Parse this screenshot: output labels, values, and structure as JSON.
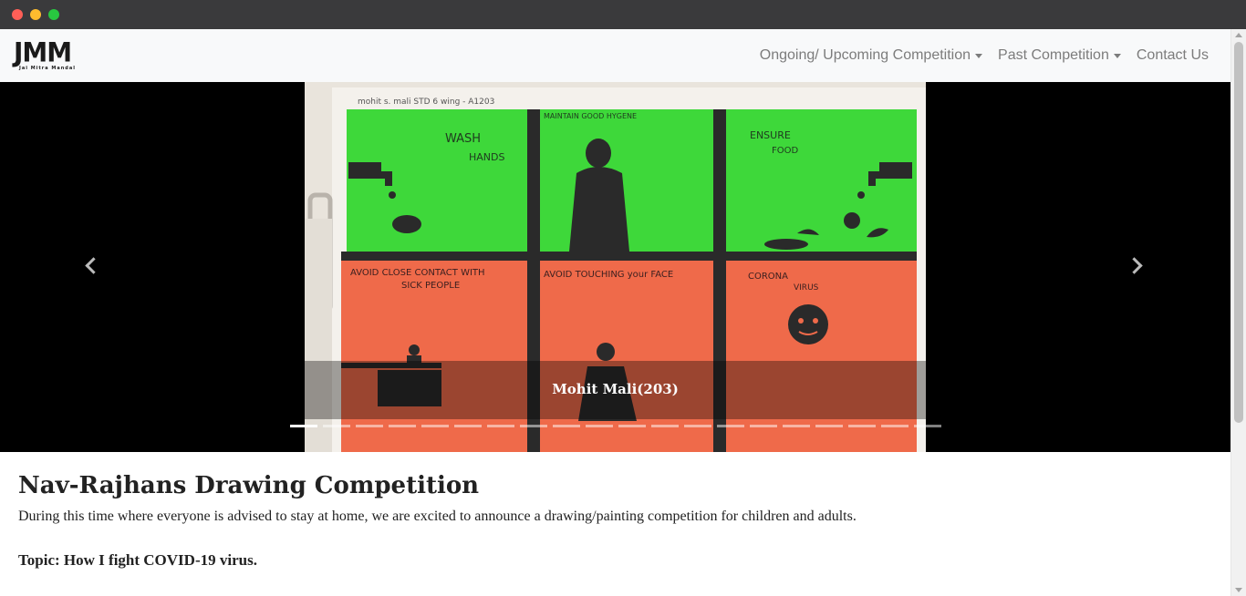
{
  "brand": {
    "logo_text": "JMM",
    "logo_subtext": "Jai Mitra Mandal"
  },
  "nav": {
    "items": [
      {
        "label": "Ongoing/ Upcoming Competition",
        "dropdown": true
      },
      {
        "label": "Past Competition",
        "dropdown": true
      },
      {
        "label": "Contact Us",
        "dropdown": false
      }
    ]
  },
  "carousel": {
    "caption": "Mohit Mali(203)",
    "indicator_count": 20,
    "active_index": 0,
    "drawing": {
      "header": "mohit s. mali    STD 6    wing - A1203",
      "panels": [
        {
          "text": "WASH\nHANDS"
        },
        {
          "text": "MAINTAIN GOOD HYGENE"
        },
        {
          "text": "ENSURE\nFOOD"
        },
        {
          "text": "AVOID CLOSE CONTACT WITH\nSICK PEOPLE"
        },
        {
          "text": "AVOID TOUCHING your FACE"
        },
        {
          "text": "CORONA\nVIRUS"
        }
      ]
    }
  },
  "content": {
    "title": "Nav-Rajhans Drawing Competition",
    "intro": "During this time where everyone is advised to stay at home, we are excited to announce a drawing/painting competition for children and adults.",
    "topic": "Topic: How I fight COVID-19 virus."
  },
  "colors": {
    "navbar_bg": "#f8f9fa",
    "nav_link": "#7c7c7c",
    "drawing_green": "#3ed83a",
    "drawing_red": "#ef6a4a",
    "drawing_ink": "#2a2a2a"
  },
  "icons": [
    "chevron-left-icon",
    "chevron-right-icon",
    "dropdown-caret-icon"
  ]
}
